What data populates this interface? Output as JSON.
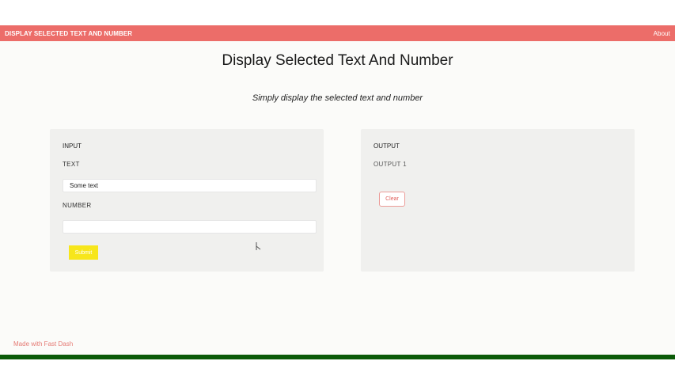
{
  "navbar": {
    "brand": "DISPLAY SELECTED TEXT AND NUMBER",
    "about": "About"
  },
  "header": {
    "title": "Display Selected Text And Number",
    "subtitle": "Simply display the selected text and number"
  },
  "input_card": {
    "title": "INPUT",
    "text_label": "TEXT",
    "text_value": "Some text",
    "number_label": "NUMBER",
    "number_value": "",
    "submit_label": "Submit"
  },
  "output_card": {
    "title": "OUTPUT",
    "output_label": "OUTPUT 1",
    "clear_label": "Clear"
  },
  "footer": {
    "credit": "Made with Fast Dash"
  },
  "colors": {
    "navbar": "#ec6d69",
    "submit": "#f7e61b",
    "bottom_bar": "#0b5a08"
  }
}
